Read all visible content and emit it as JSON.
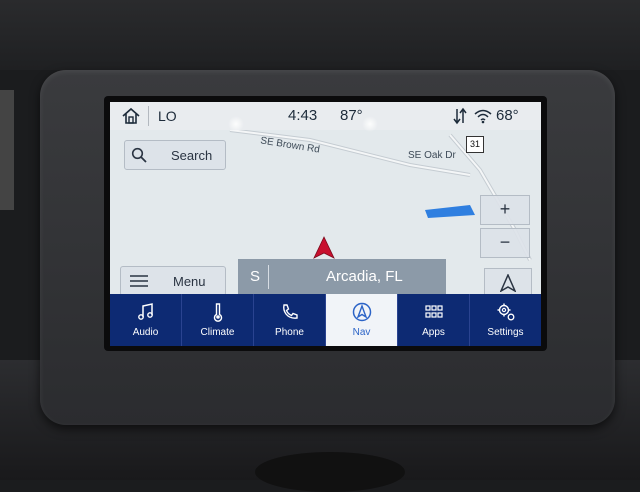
{
  "status_bar": {
    "source": "LO",
    "time": "4:43",
    "inside_temp": "87°",
    "outside_temp": "68°"
  },
  "map": {
    "roads": [
      "SE Brown Rd",
      "SE Oak Dr"
    ],
    "route_shield": "31",
    "search_label": "Search",
    "menu_label": "Menu",
    "zoom_in_label": "+",
    "zoom_out_label": "−",
    "destination": {
      "direction": "S",
      "city": "Arcadia, FL"
    }
  },
  "nav_bar": {
    "items": [
      {
        "label": "Audio",
        "icon": "music-note-icon"
      },
      {
        "label": "Climate",
        "icon": "thermometer-icon"
      },
      {
        "label": "Phone",
        "icon": "phone-icon"
      },
      {
        "label": "Nav",
        "icon": "navigation-icon",
        "active": true
      },
      {
        "label": "Apps",
        "icon": "apps-grid-icon"
      },
      {
        "label": "Settings",
        "icon": "settings-gear-icon"
      }
    ]
  },
  "colors": {
    "nav_bar_bg": "#0d2a73",
    "active_tab_bg": "#f1f4f8",
    "active_tab_text": "#2c64c7",
    "position_marker": "#c8102e"
  }
}
